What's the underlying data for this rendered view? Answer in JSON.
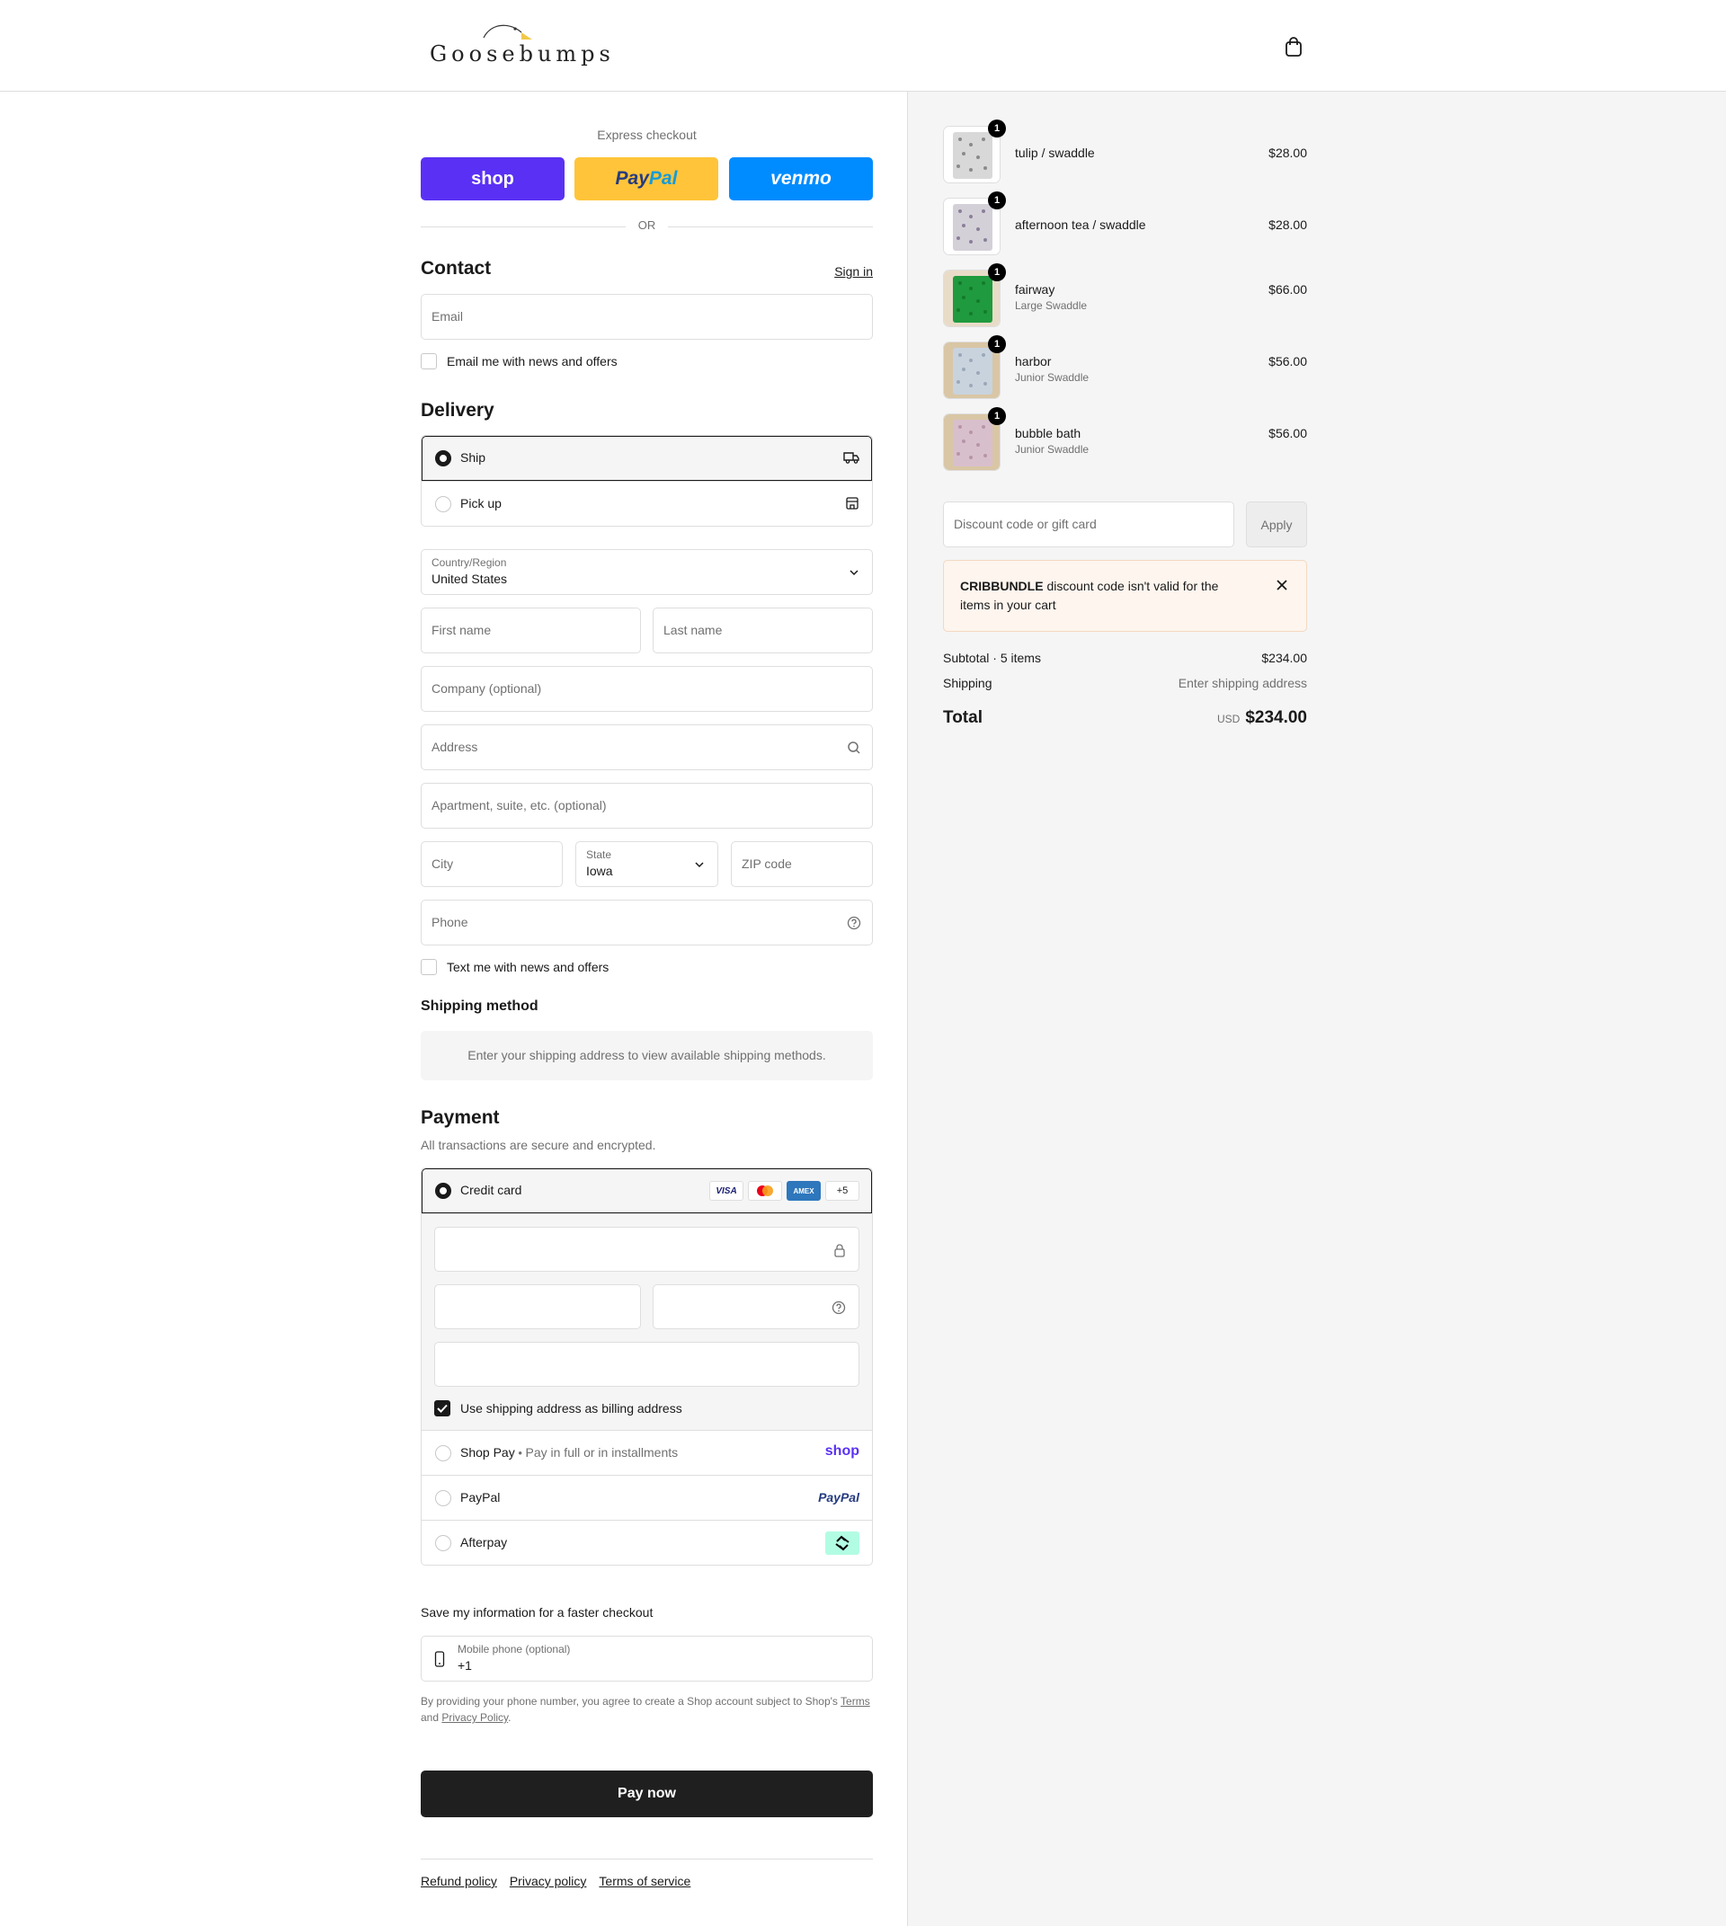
{
  "brand": {
    "logo_text": "Goosebumps"
  },
  "express": {
    "label": "Express checkout",
    "shop": "shop",
    "paypal_a": "Pay",
    "paypal_b": "Pal",
    "venmo": "venmo",
    "or": "OR"
  },
  "contact": {
    "title": "Contact",
    "sign_in": "Sign in",
    "email_placeholder": "Email",
    "news_label": "Email me with news and offers"
  },
  "delivery": {
    "title": "Delivery",
    "options": [
      {
        "label": "Ship",
        "selected": true
      },
      {
        "label": "Pick up",
        "selected": false
      }
    ],
    "country_label": "Country/Region",
    "country_value": "United States",
    "first_name": "First name",
    "last_name": "Last name",
    "company": "Company (optional)",
    "address": "Address",
    "apartment": "Apartment, suite, etc. (optional)",
    "city": "City",
    "state_label": "State",
    "state_value": "Iowa",
    "zip": "ZIP code",
    "phone": "Phone",
    "text_label": "Text me with news and offers"
  },
  "shipping_method": {
    "title": "Shipping method",
    "message": "Enter your shipping address to view available shipping methods."
  },
  "payment": {
    "title": "Payment",
    "subtitle": "All transactions are secure and encrypted.",
    "credit_card": "Credit card",
    "brands": [
      "VISA",
      "AMEX",
      "+5"
    ],
    "billing_label": "Use shipping address as billing address",
    "shop_pay": "Shop Pay",
    "shop_pay_sub": "Pay in full or in installments",
    "shop_logo": "shop",
    "paypal": "PayPal",
    "paypal_logo": "PayPal",
    "afterpay": "Afterpay"
  },
  "save_info": {
    "title": "Save my information for a faster checkout",
    "phone_label": "Mobile phone (optional)",
    "phone_value": "+1",
    "fine_1": "By providing your phone number, you agree to create a Shop account subject to Shop's",
    "terms": "Terms",
    "and": "and",
    "privacy": "Privacy Policy",
    "period": "."
  },
  "pay_now": "Pay now",
  "footer": [
    "Refund policy",
    "Privacy policy",
    "Terms of service"
  ],
  "cart": {
    "items": [
      {
        "name": "tulip / swaddle",
        "variant": "",
        "price": "$28.00",
        "qty": "1"
      },
      {
        "name": "afternoon tea / swaddle",
        "variant": "",
        "price": "$28.00",
        "qty": "1"
      },
      {
        "name": "fairway",
        "variant": "Large Swaddle",
        "price": "$66.00",
        "qty": "1"
      },
      {
        "name": "harbor",
        "variant": "Junior Swaddle",
        "price": "$56.00",
        "qty": "1"
      },
      {
        "name": "bubble bath",
        "variant": "Junior Swaddle",
        "price": "$56.00",
        "qty": "1"
      }
    ],
    "discount_placeholder": "Discount code or gift card",
    "apply": "Apply",
    "alert_code": "CRIBBUNDLE",
    "alert_msg": " discount code isn't valid for the items in your cart",
    "subtotal_label": "Subtotal · 5 items",
    "subtotal_value": "$234.00",
    "shipping_label": "Shipping",
    "shipping_value": "Enter shipping address",
    "total_label": "Total",
    "currency": "USD",
    "total_value": "$234.00"
  }
}
